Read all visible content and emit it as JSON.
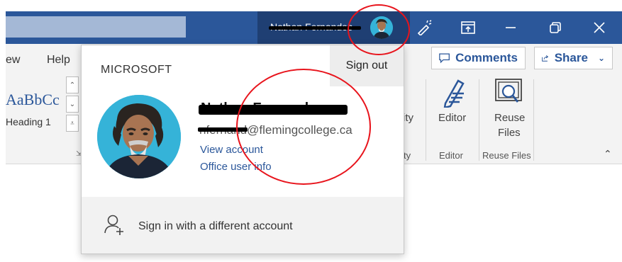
{
  "titlebar": {
    "user_name": "Nathan Fernandes",
    "accent_color": "#2b579a",
    "buttons": [
      {
        "name": "coauthoring-icon"
      },
      {
        "name": "ribbon-display-icon"
      },
      {
        "name": "minimize-icon"
      },
      {
        "name": "restore-icon"
      },
      {
        "name": "close-icon"
      }
    ]
  },
  "ribbon": {
    "tabs": [
      "ew",
      "Help"
    ],
    "style_sample": "AaBbCc",
    "style_name": "Heading 1",
    "comments_label": "Comments",
    "share_label": "Share",
    "editor_label": "Editor",
    "editor_group_label": "Editor",
    "reuse_label_line1": "Reuse",
    "reuse_label_line2": "Files",
    "reuse_group_label": "Reuse Files",
    "partial_label_1": "ity",
    "partial_label_2": "ty"
  },
  "account": {
    "section_label": "MICROSOFT",
    "sign_out_label": "Sign out",
    "display_name": "Nathan Fernandes",
    "email": "nfernand@flemingcollege.ca",
    "view_account_label": "View account",
    "office_user_info_label": "Office user info",
    "sign_in_different_label": "Sign in with a different account"
  }
}
